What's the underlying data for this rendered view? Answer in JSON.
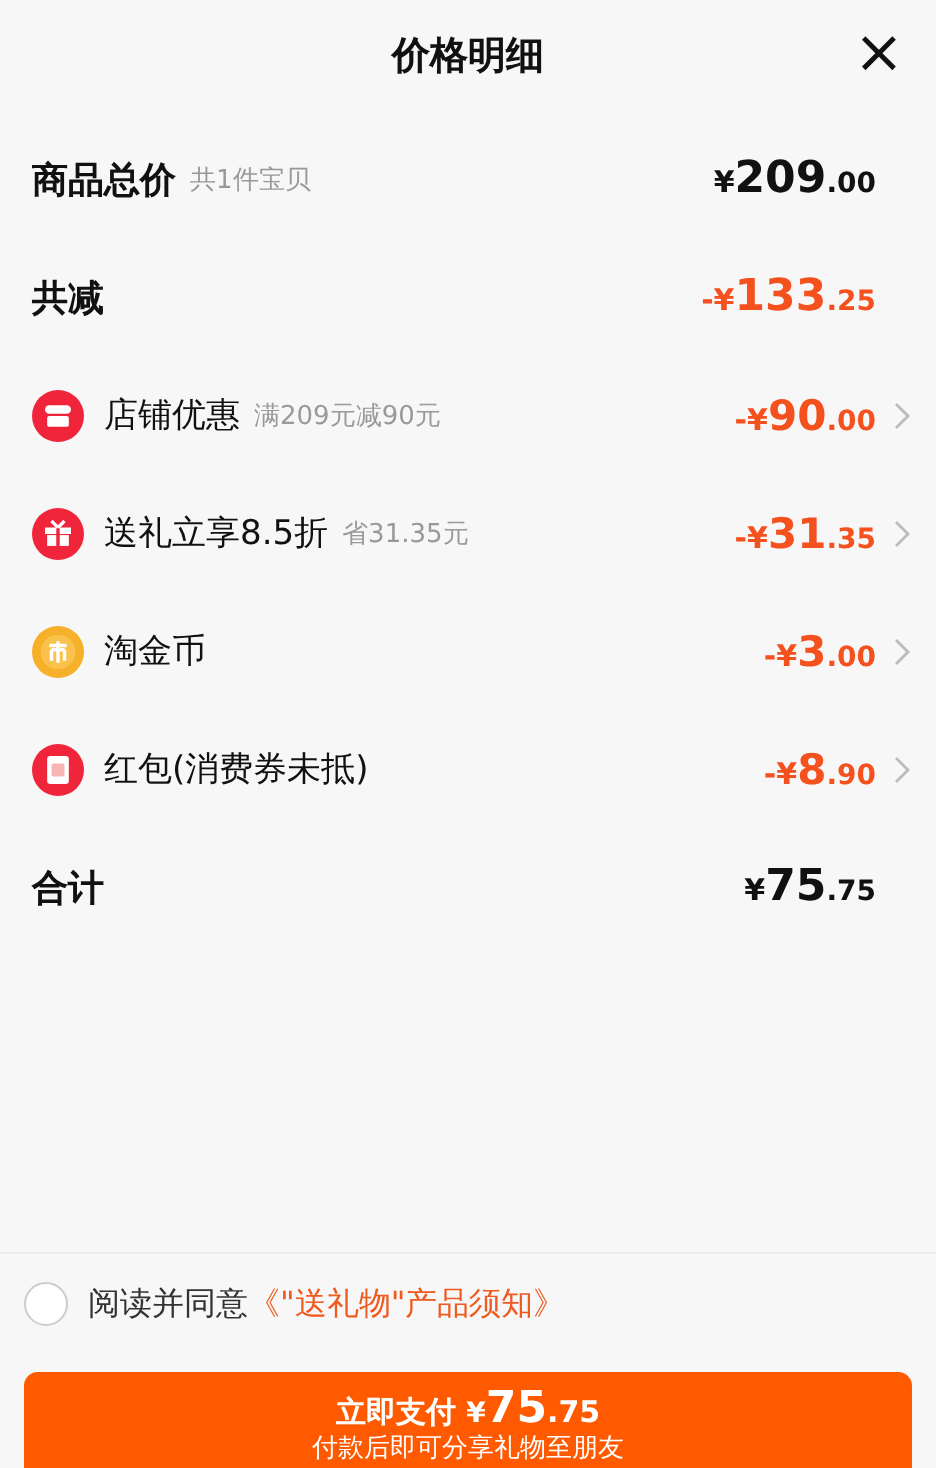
{
  "header": {
    "title": "价格明细",
    "close": "×"
  },
  "rows": [
    {
      "kind": "plain",
      "label": "商品总价",
      "note": "共1件宝贝",
      "amount": "¥209.00",
      "discount": false
    },
    {
      "kind": "plain",
      "label": "共减",
      "amount": "-¥133.25",
      "discount": true
    },
    {
      "kind": "detail",
      "label": "店铺优惠",
      "note": "满209元减90元",
      "amount": "-¥90.00",
      "discount": true
    },
    {
      "kind": "detail",
      "label": "送礼立享8.5折",
      "note": "省31.35元",
      "amount": "-¥31.35",
      "discount": true
    },
    {
      "kind": "detail",
      "label": "淘金币",
      "amount": "-¥3.00",
      "discount": true
    },
    {
      "kind": "detail",
      "label": "红包(消费券未抵)",
      "amount": "-¥8.90",
      "discount": true
    },
    {
      "kind": "plain",
      "label": "合计",
      "amount": "¥75.75",
      "discount": false
    }
  ],
  "agreement": {
    "checked": false,
    "text": "阅读并同意",
    "link": "《\"送礼物\"产品须知》"
  },
  "pay_button": {
    "label": "立即支付",
    "amount": "¥75.75",
    "subtitle": "付款后即可分享礼物至朋友"
  }
}
